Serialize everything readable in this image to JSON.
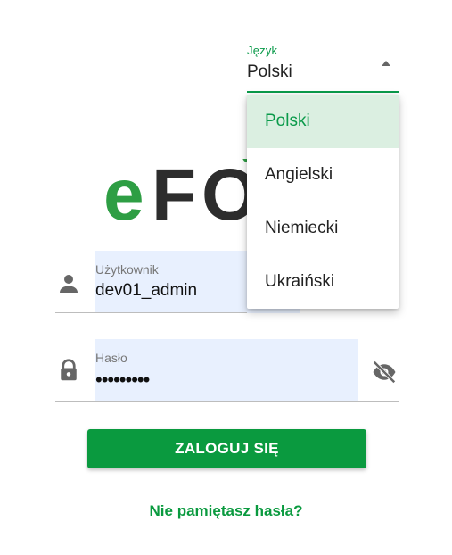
{
  "language": {
    "label": "Język",
    "selected": "Polski",
    "options": [
      "Polski",
      "Angielski",
      "Niemiecki",
      "Ukraiński"
    ]
  },
  "login": {
    "username_label": "Użytkownik",
    "username_value": "dev01_admin",
    "password_label": "Hasło",
    "password_mask": "•••••••••",
    "submit_label": "ZALOGUJ SIĘ",
    "forgot_label": "Nie pamiętasz hasła?"
  },
  "colors": {
    "accent": "#0a9a3f",
    "selected_bg": "#dbefe1",
    "field_bg": "#e8f0fe"
  },
  "icons": {
    "user": "person-icon",
    "password": "lock-icon",
    "toggle": "eye-off-icon"
  }
}
